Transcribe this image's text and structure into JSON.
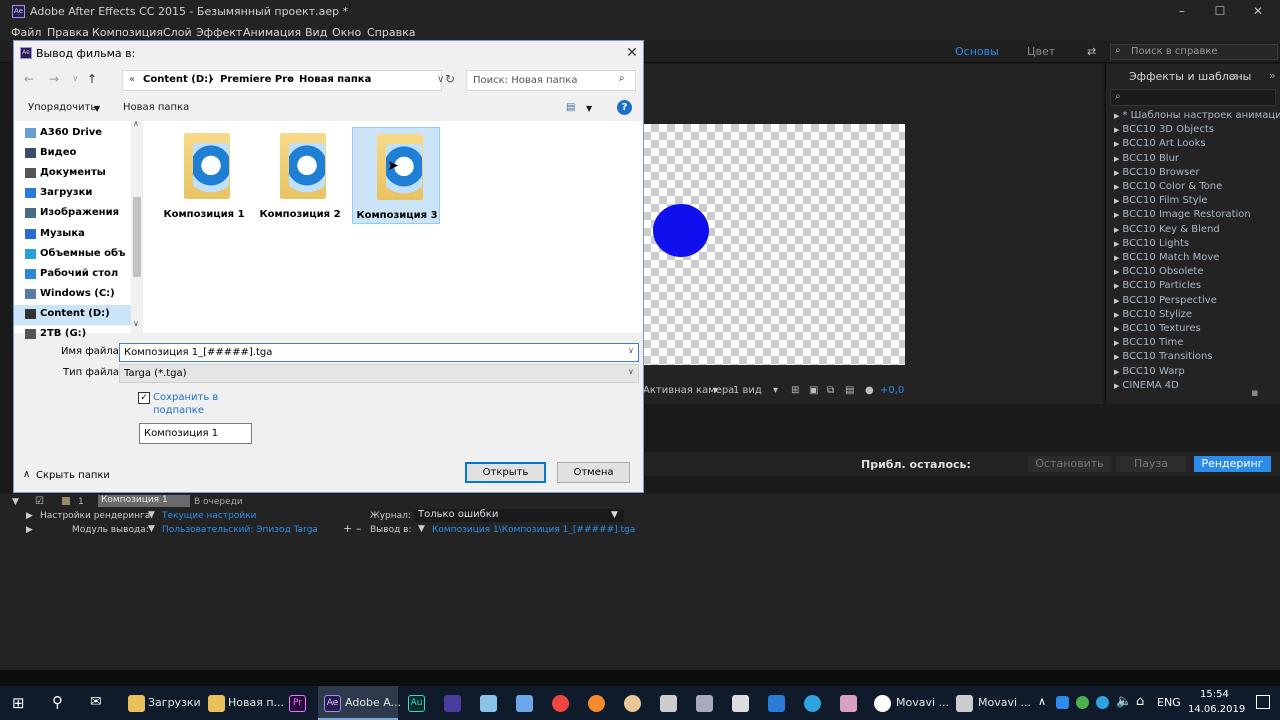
{
  "window": {
    "title": "Adobe After Effects CC 2015 - Безымянный проект.aep *",
    "app_icon": "Ae"
  },
  "menu": [
    "Файл",
    "Правка",
    "Композиция",
    "Слой",
    "Эффект",
    "Анимация",
    "Вид",
    "Окно",
    "Справка"
  ],
  "workspaces": {
    "basic": "Основы",
    "color": "Цвет"
  },
  "help_search": {
    "placeholder": "Поиск в справке"
  },
  "viewer": {
    "camera": "Активная камера",
    "views": "1 вид",
    "exposure": "+0,0"
  },
  "effects_panel": {
    "title": "Эффекты и шаблоны",
    "items": [
      "* Шаблоны настроек анимации",
      "BCC10 3D Objects",
      "BCC10 Art Looks",
      "BCC10 Blur",
      "BCC10 Browser",
      "BCC10 Color & Tone",
      "BCC10 Film Style",
      "BCC10 Image Restoration",
      "BCC10 Key & Blend",
      "BCC10 Lights",
      "BCC10 Match Move",
      "BCC10 Obsolete",
      "BCC10 Particles",
      "BCC10 Perspective",
      "BCC10 Stylize",
      "BCC10 Textures",
      "BCC10 Time",
      "BCC10 Transitions",
      "BCC10 Warp",
      "CINEMA 4D"
    ]
  },
  "render": {
    "remaining_label": "Прибл. осталось:",
    "stop": "Остановить",
    "pause": "Пауза",
    "render": "Рендеринг"
  },
  "queue": {
    "index": "1",
    "comp": "Композиция 1",
    "status": "В очереди",
    "settings_label": "Настройки рендеринга:",
    "settings_value": "Текущие настройки",
    "module_label": "Модуль вывода:",
    "module_value": "Пользовательский: Эпизод Targa",
    "log_label": "Журнал:",
    "log_value": "Только ошибки",
    "output_label": "Вывод в:",
    "output_value": "Композиция 1\\Композиция 1_[#####].tga"
  },
  "dialog": {
    "title": "Вывод фильма в:",
    "path": [
      "Content (D:)",
      "Premiere Pro",
      "Новая папка"
    ],
    "search_placeholder": "Поиск: Новая папка",
    "organize": "Упорядочить",
    "new_folder": "Новая папка",
    "nav_items": [
      "A360 Drive",
      "Видео",
      "Документы",
      "Загрузки",
      "Изображения",
      "Музыка",
      "Объемные объ",
      "Рабочий стол",
      "Windows (C:)",
      "Content (D:)",
      "2TB (G:)"
    ],
    "folders": [
      "Композиция 1",
      "Композиция 2",
      "Композиция 3"
    ],
    "filename_label": "Имя файла:",
    "filename_value": "Композиция 1_[#####].tga",
    "filetype_label": "Тип файла:",
    "filetype_value": "Targa (*.tga)",
    "subfolder_line1": "Сохранить в",
    "subfolder_line2": "подпапке",
    "subfolder_name": "Композиция 1",
    "hide_folders": "Скрыть папки",
    "open": "Открыть",
    "cancel": "Отмена"
  },
  "taskbar": {
    "items": [
      "Загрузки",
      "Новая п...",
      "Adobe A...",
      "Movavi ...",
      "Movavi ..."
    ],
    "lang": "ENG",
    "time": "15:54",
    "date": "14.06.2019"
  },
  "colors": {
    "accent": "#2d8ceb",
    "circle": "#1010ee",
    "render_button": "#2d8ceb"
  }
}
